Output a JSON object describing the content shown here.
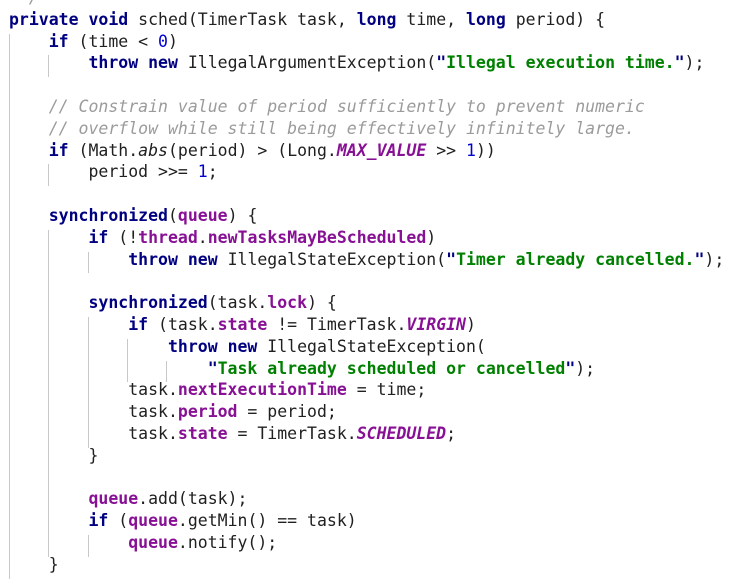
{
  "editor": {
    "language": "java",
    "theme": "light",
    "font_family_hint": "monospace",
    "colors": {
      "background": "#ffffff",
      "default_text": "#202020",
      "keyword": "#000080",
      "string": "#008000",
      "comment": "#9b9b9b",
      "number": "#0000d0",
      "field": "#871094",
      "static_field": "#871094",
      "indent_guide": "#c8c8c8"
    },
    "indent_guide_columns": [
      0,
      4,
      8,
      12,
      16
    ]
  },
  "code": {
    "lines": [
      {
        "n": 0,
        "indent": 0,
        "tokens": [
          {
            "t": " */",
            "c": "cmt"
          }
        ]
      },
      {
        "n": 1,
        "indent": 0,
        "tokens": [
          {
            "t": "private",
            "c": "kw"
          },
          {
            "t": " ",
            "c": "plain"
          },
          {
            "t": "void",
            "c": "kw"
          },
          {
            "t": " sched(TimerTask task, ",
            "c": "plain"
          },
          {
            "t": "long",
            "c": "kw"
          },
          {
            "t": " time, ",
            "c": "plain"
          },
          {
            "t": "long",
            "c": "kw"
          },
          {
            "t": " period) {",
            "c": "plain"
          }
        ]
      },
      {
        "n": 2,
        "indent": 4,
        "tokens": [
          {
            "t": "if",
            "c": "kw"
          },
          {
            "t": " (time < ",
            "c": "plain"
          },
          {
            "t": "0",
            "c": "num"
          },
          {
            "t": ")",
            "c": "plain"
          }
        ]
      },
      {
        "n": 3,
        "indent": 8,
        "tokens": [
          {
            "t": "throw",
            "c": "kw"
          },
          {
            "t": " ",
            "c": "plain"
          },
          {
            "t": "new",
            "c": "kw"
          },
          {
            "t": " IllegalArgumentException(",
            "c": "plain"
          },
          {
            "t": "\"",
            "c": "quo"
          },
          {
            "t": "Illegal execution time.",
            "c": "str"
          },
          {
            "t": "\"",
            "c": "quo"
          },
          {
            "t": ");",
            "c": "plain"
          }
        ]
      },
      {
        "n": 4,
        "indent": 0,
        "tokens": []
      },
      {
        "n": 5,
        "indent": 4,
        "tokens": [
          {
            "t": "// Constrain value of period sufficiently to prevent numeric",
            "c": "cmt"
          }
        ]
      },
      {
        "n": 6,
        "indent": 4,
        "tokens": [
          {
            "t": "// overflow while still being effectively infinitely large.",
            "c": "cmt"
          }
        ]
      },
      {
        "n": 7,
        "indent": 4,
        "tokens": [
          {
            "t": "if",
            "c": "kw"
          },
          {
            "t": " (Math.",
            "c": "plain"
          },
          {
            "t": "abs",
            "c": "smth"
          },
          {
            "t": "(period) > (Long.",
            "c": "plain"
          },
          {
            "t": "MAX_VALUE",
            "c": "sfld"
          },
          {
            "t": " >> ",
            "c": "plain"
          },
          {
            "t": "1",
            "c": "num"
          },
          {
            "t": "))",
            "c": "plain"
          }
        ]
      },
      {
        "n": 8,
        "indent": 8,
        "tokens": [
          {
            "t": "period >>= ",
            "c": "plain"
          },
          {
            "t": "1",
            "c": "num"
          },
          {
            "t": ";",
            "c": "plain"
          }
        ]
      },
      {
        "n": 9,
        "indent": 0,
        "tokens": []
      },
      {
        "n": 10,
        "indent": 4,
        "tokens": [
          {
            "t": "synchronized",
            "c": "kw"
          },
          {
            "t": "(",
            "c": "plain"
          },
          {
            "t": "queue",
            "c": "fld"
          },
          {
            "t": ") {",
            "c": "plain"
          }
        ]
      },
      {
        "n": 11,
        "indent": 8,
        "tokens": [
          {
            "t": "if",
            "c": "kw"
          },
          {
            "t": " (!",
            "c": "plain"
          },
          {
            "t": "thread",
            "c": "fld"
          },
          {
            "t": ".",
            "c": "plain"
          },
          {
            "t": "newTasksMayBeScheduled",
            "c": "fld"
          },
          {
            "t": ")",
            "c": "plain"
          }
        ]
      },
      {
        "n": 12,
        "indent": 12,
        "tokens": [
          {
            "t": "throw",
            "c": "kw"
          },
          {
            "t": " ",
            "c": "plain"
          },
          {
            "t": "new",
            "c": "kw"
          },
          {
            "t": " IllegalStateException(",
            "c": "plain"
          },
          {
            "t": "\"",
            "c": "quo"
          },
          {
            "t": "Timer already cancelled.",
            "c": "str"
          },
          {
            "t": "\"",
            "c": "quo"
          },
          {
            "t": ");",
            "c": "plain"
          }
        ]
      },
      {
        "n": 13,
        "indent": 0,
        "tokens": []
      },
      {
        "n": 14,
        "indent": 8,
        "tokens": [
          {
            "t": "synchronized",
            "c": "kw"
          },
          {
            "t": "(task.",
            "c": "plain"
          },
          {
            "t": "lock",
            "c": "fld"
          },
          {
            "t": ") {",
            "c": "plain"
          }
        ]
      },
      {
        "n": 15,
        "indent": 12,
        "tokens": [
          {
            "t": "if",
            "c": "kw"
          },
          {
            "t": " (task.",
            "c": "plain"
          },
          {
            "t": "state",
            "c": "fld"
          },
          {
            "t": " != TimerTask.",
            "c": "plain"
          },
          {
            "t": "VIRGIN",
            "c": "sfld"
          },
          {
            "t": ")",
            "c": "plain"
          }
        ]
      },
      {
        "n": 16,
        "indent": 16,
        "tokens": [
          {
            "t": "throw",
            "c": "kw"
          },
          {
            "t": " ",
            "c": "plain"
          },
          {
            "t": "new",
            "c": "kw"
          },
          {
            "t": " IllegalStateException(",
            "c": "plain"
          }
        ]
      },
      {
        "n": 17,
        "indent": 20,
        "tokens": [
          {
            "t": "\"",
            "c": "quo"
          },
          {
            "t": "Task already scheduled or cancelled",
            "c": "str"
          },
          {
            "t": "\"",
            "c": "quo"
          },
          {
            "t": ");",
            "c": "plain"
          }
        ]
      },
      {
        "n": 18,
        "indent": 12,
        "tokens": [
          {
            "t": "task.",
            "c": "plain"
          },
          {
            "t": "nextExecutionTime",
            "c": "fld"
          },
          {
            "t": " = time;",
            "c": "plain"
          }
        ]
      },
      {
        "n": 19,
        "indent": 12,
        "tokens": [
          {
            "t": "task.",
            "c": "plain"
          },
          {
            "t": "period",
            "c": "fld"
          },
          {
            "t": " = period;",
            "c": "plain"
          }
        ]
      },
      {
        "n": 20,
        "indent": 12,
        "tokens": [
          {
            "t": "task.",
            "c": "plain"
          },
          {
            "t": "state",
            "c": "fld"
          },
          {
            "t": " = TimerTask.",
            "c": "plain"
          },
          {
            "t": "SCHEDULED",
            "c": "sfld"
          },
          {
            "t": ";",
            "c": "plain"
          }
        ]
      },
      {
        "n": 21,
        "indent": 8,
        "tokens": [
          {
            "t": "}",
            "c": "plain"
          }
        ]
      },
      {
        "n": 22,
        "indent": 0,
        "tokens": []
      },
      {
        "n": 23,
        "indent": 8,
        "tokens": [
          {
            "t": "queue",
            "c": "fld"
          },
          {
            "t": ".add(task);",
            "c": "plain"
          }
        ]
      },
      {
        "n": 24,
        "indent": 8,
        "tokens": [
          {
            "t": "if",
            "c": "kw"
          },
          {
            "t": " (",
            "c": "plain"
          },
          {
            "t": "queue",
            "c": "fld"
          },
          {
            "t": ".getMin() == task)",
            "c": "plain"
          }
        ]
      },
      {
        "n": 25,
        "indent": 12,
        "tokens": [
          {
            "t": "queue",
            "c": "fld"
          },
          {
            "t": ".notify();",
            "c": "plain"
          }
        ]
      },
      {
        "n": 26,
        "indent": 4,
        "tokens": [
          {
            "t": "}",
            "c": "plain"
          }
        ]
      }
    ]
  }
}
